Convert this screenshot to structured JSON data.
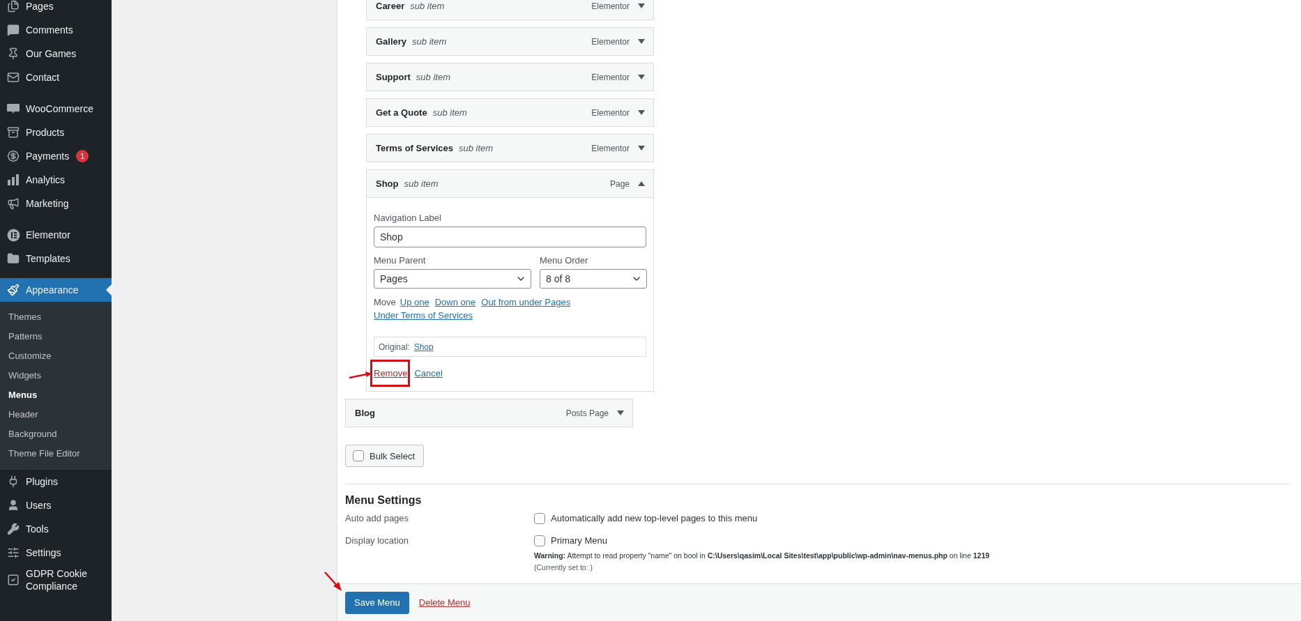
{
  "sidebar": {
    "groups": [
      {
        "items": [
          {
            "label": "Pages",
            "selected": false
          },
          {
            "label": "Comments",
            "selected": false
          },
          {
            "label": "Our Games",
            "selected": false
          },
          {
            "label": "Contact",
            "selected": false
          }
        ]
      },
      {
        "items": [
          {
            "label": "WooCommerce",
            "selected": false
          },
          {
            "label": "Products",
            "selected": false
          },
          {
            "label": "Payments",
            "selected": false,
            "badge": "1"
          },
          {
            "label": "Analytics",
            "selected": false
          },
          {
            "label": "Marketing",
            "selected": false
          }
        ]
      },
      {
        "items": [
          {
            "label": "Elementor",
            "selected": false
          },
          {
            "label": "Templates",
            "selected": false
          }
        ]
      },
      {
        "items": [
          {
            "label": "Appearance",
            "selected": true,
            "children": [
              {
                "label": "Themes",
                "selected": false
              },
              {
                "label": "Patterns",
                "selected": false
              },
              {
                "label": "Customize",
                "selected": false
              },
              {
                "label": "Widgets",
                "selected": false
              },
              {
                "label": "Menus",
                "selected": true
              },
              {
                "label": "Header",
                "selected": false
              },
              {
                "label": "Background",
                "selected": false
              },
              {
                "label": "Theme File Editor",
                "selected": false
              }
            ]
          },
          {
            "label": "Plugins",
            "selected": false
          },
          {
            "label": "Users",
            "selected": false
          },
          {
            "label": "Tools",
            "selected": false
          },
          {
            "label": "Settings",
            "selected": false
          },
          {
            "label": "GDPR Cookie Compliance",
            "selected": false
          }
        ]
      }
    ]
  },
  "menu_items": [
    {
      "kind": "sub_item",
      "title": "Career",
      "note": "sub item",
      "type": "Elementor",
      "expanded": false
    },
    {
      "kind": "sub_item",
      "title": "Gallery",
      "note": "sub item",
      "type": "Elementor",
      "expanded": false
    },
    {
      "kind": "sub_item",
      "title": "Support",
      "note": "sub item",
      "type": "Elementor",
      "expanded": false
    },
    {
      "kind": "sub_item",
      "title": "Get a Quote",
      "note": "sub item",
      "type": "Elementor",
      "expanded": false
    },
    {
      "kind": "sub_item",
      "title": "Terms of Services",
      "note": "sub item",
      "type": "Elementor",
      "expanded": false
    },
    {
      "kind": "sub_item",
      "title": "Shop",
      "note": "sub item",
      "type": "Page",
      "expanded": true,
      "settings": {
        "navigation_label": {
          "label": "Navigation Label",
          "value": "Shop"
        },
        "menu_parent": {
          "label": "Menu Parent",
          "value": "Pages"
        },
        "menu_order": {
          "label": "Menu Order",
          "value": "8 of 8"
        },
        "move": {
          "label": "Move",
          "links": [
            "Up one",
            "Down one",
            "Out from under Pages",
            "Under Terms of Services"
          ]
        },
        "original": {
          "label": "Original:",
          "link": "Shop"
        },
        "remove": "Remove",
        "cancel": "Cancel"
      }
    },
    {
      "kind": "top_item",
      "title": "Blog",
      "type": "Posts Page",
      "expanded": false
    }
  ],
  "bulk_select": {
    "label": "Bulk Select",
    "checked": false
  },
  "menu_settings": {
    "title": "Menu Settings",
    "rows": [
      {
        "label": "Auto add pages",
        "options": [
          {
            "label": "Automatically add new top-level pages to this menu",
            "checked": false
          }
        ]
      },
      {
        "label": "Display location",
        "options": [
          {
            "label": "Primary Menu",
            "checked": false
          }
        ],
        "warning": "**Warning:** Attempt to read property \"name\" on bool in **C:\\Users\\qasim\\Local Sites\\test\\app\\public\\wp-admin\\nav-menus.php** on line **1219**",
        "note": "(Currently set to: )"
      }
    ]
  },
  "footer": {
    "save": "Save Menu",
    "delete": "Delete Menu"
  }
}
